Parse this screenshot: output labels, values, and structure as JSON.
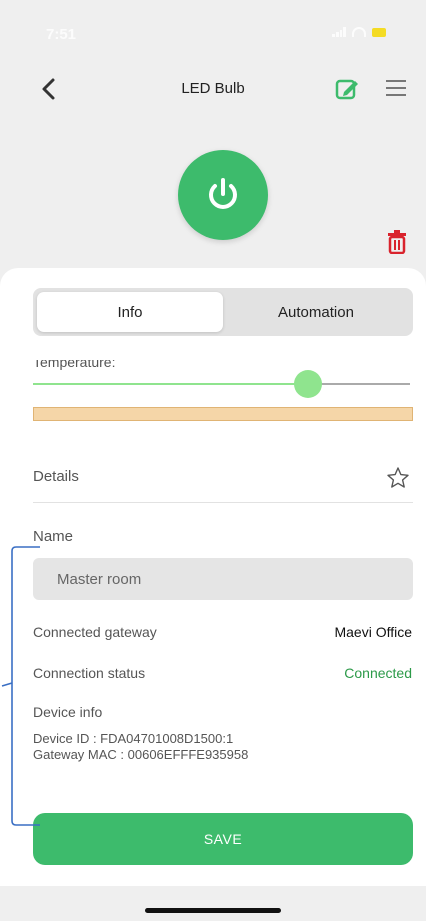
{
  "status_bar": {
    "time": "7:51"
  },
  "nav": {
    "title": "LED Bulb"
  },
  "tabs": [
    {
      "label": "Info"
    },
    {
      "label": "Automation"
    }
  ],
  "temperature": {
    "label": "Temperature:",
    "level_fraction": 0.73
  },
  "details": {
    "label": "Details"
  },
  "name": {
    "label": "Name",
    "value": "Master room"
  },
  "gateway": {
    "label": "Connected gateway",
    "value": "Maevi Office"
  },
  "connection": {
    "label": "Connection status",
    "value": "Connected"
  },
  "device_info": {
    "label": "Device info",
    "device_id": "Device ID : FDA04701008D1500:1",
    "gateway_mac": "Gateway MAC : 00606EFFFE935958"
  },
  "save_label": "SAVE",
  "colors": {
    "accent": "#3dbb6c",
    "status_connected": "#2c9a49",
    "trash": "#d9232d",
    "slider": "#8fe48e"
  }
}
